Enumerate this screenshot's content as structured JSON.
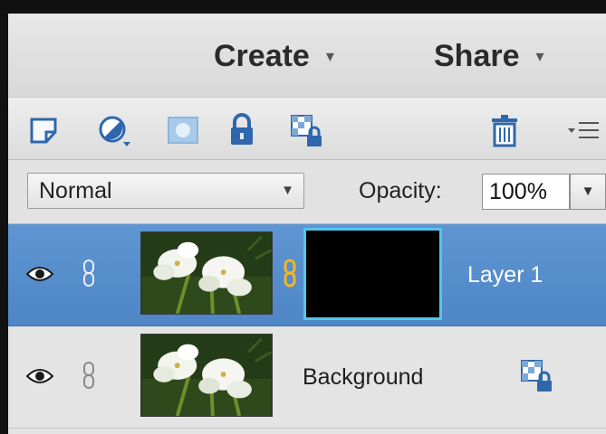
{
  "header": {
    "create_label": "Create",
    "share_label": "Share",
    "caret": "▾"
  },
  "toolbar": {
    "icons": [
      "new-layer-icon",
      "adjustment-layer-icon",
      "layer-mask-icon",
      "lock-all-icon",
      "lock-transparency-icon",
      "delete-layer-icon",
      "panel-menu-icon"
    ]
  },
  "options": {
    "blend_mode": "Normal",
    "opacity_label": "Opacity:",
    "opacity_value": "100%",
    "dropdown_caret": "▼"
  },
  "layers": [
    {
      "name": "Layer 1",
      "selected": true,
      "has_mask": true
    },
    {
      "name": "Background",
      "selected": false,
      "locked": true
    }
  ],
  "colors": {
    "selection": "#5a90cf",
    "mask_outline": "#53c6ee",
    "lock_icon": "#2a6fbf"
  }
}
